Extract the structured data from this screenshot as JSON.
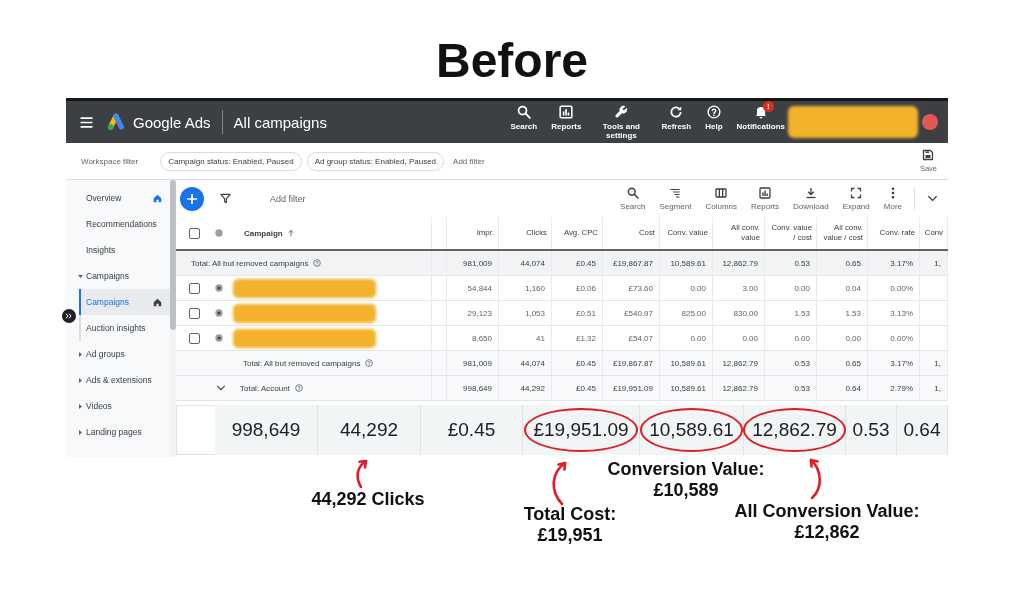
{
  "heading": "Before",
  "top_bar": {
    "product_name": "Google Ads",
    "page_title": "All campaigns",
    "actions": [
      {
        "label": "Search"
      },
      {
        "label": "Reports"
      },
      {
        "label": "Tools and settings"
      },
      {
        "label": "Refresh"
      },
      {
        "label": "Help"
      },
      {
        "label": "Notifications",
        "badge": "!"
      }
    ]
  },
  "filter_bar": {
    "label": "Workspace filter",
    "chips": [
      "Campaign status: Enabled, Paused",
      "Ad group status: Enabled, Paused"
    ],
    "add_filter": "Add filter",
    "save": "Save"
  },
  "sidebar": {
    "items": [
      {
        "label": "Overview",
        "selected": false,
        "home_page": true
      },
      {
        "label": "Recommendations",
        "selected": false,
        "home_page": false
      },
      {
        "label": "Insights",
        "selected": false,
        "home_page": false
      },
      {
        "label": "Campaigns",
        "selected": false,
        "home_page": false,
        "expanded": true,
        "children": [
          {
            "label": "Campaigns",
            "selected": true,
            "home_page": true
          },
          {
            "label": "Auction insights",
            "selected": false,
            "home_page": false
          }
        ]
      },
      {
        "label": "Ad groups",
        "selected": false,
        "home_page": false,
        "expanded": false
      },
      {
        "label": "Ads & extensions",
        "selected": false,
        "home_page": false,
        "expanded": false
      },
      {
        "label": "Videos",
        "selected": false,
        "home_page": false,
        "expanded": false
      },
      {
        "label": "Landing pages",
        "selected": false,
        "home_page": false,
        "expanded": false
      }
    ]
  },
  "toolbar": {
    "add_filter": "Add filter",
    "tools": [
      "Search",
      "Segment",
      "Columns",
      "Reports",
      "Download",
      "Expand",
      "More"
    ]
  },
  "table": {
    "header_checkbox": {
      "checked": false
    },
    "columns": [
      {
        "label": "Campaign",
        "sorted": true
      },
      {
        "label": "Impr.",
        "sorted": false
      },
      {
        "label": "Clicks",
        "sorted": false
      },
      {
        "label": "Avg. CPC",
        "sorted": false
      },
      {
        "label": "Cost",
        "sorted": false
      },
      {
        "label": "Conv. value",
        "sorted": false
      },
      {
        "label": "All conv. value",
        "sorted": false
      },
      {
        "label": "Conv. value / cost",
        "sorted": false
      },
      {
        "label": "All conv. value / cost",
        "sorted": false
      },
      {
        "label": "Conv. rate",
        "sorted": false
      },
      {
        "label": "Conv",
        "sorted": false
      }
    ],
    "rows": [
      {
        "kind": "total",
        "cells": [
          "Total: All but removed campaigns",
          "981,009",
          "44,074",
          "£0.45",
          "£19,867.87",
          "10,589.61",
          "12,862.79",
          "0.53",
          "0.65",
          "3.17%",
          "1,"
        ]
      },
      {
        "kind": "campaign",
        "checked": false,
        "cells": [
          "",
          "54,844",
          "1,160",
          "£0.06",
          "£73.60",
          "0.00",
          "3.00",
          "0.00",
          "0.04",
          "0.00%"
        ]
      },
      {
        "kind": "campaign",
        "checked": false,
        "cells": [
          "",
          "29,123",
          "1,053",
          "£0.51",
          "£540.97",
          "825.00",
          "830.00",
          "1.53",
          "1.53",
          "3.13%"
        ]
      },
      {
        "kind": "campaign",
        "checked": false,
        "cells": [
          "",
          "8,650",
          "41",
          "£1.32",
          "£54.07",
          "0.00",
          "0.00",
          "0.00",
          "0.00",
          "0.00%"
        ]
      },
      {
        "kind": "subtotal",
        "cells": [
          "Total: All but removed campaigns",
          "981,009",
          "44,074",
          "£0.45",
          "£19,867.87",
          "10,589.61",
          "12,862.79",
          "0.53",
          "0.65",
          "3.17%",
          "1,"
        ]
      },
      {
        "kind": "account",
        "expanded": true,
        "cells": [
          "Total: Account",
          "998,649",
          "44,292",
          "£0.45",
          "£19,951.09",
          "10,589.61",
          "12,862.79",
          "0.53",
          "0.64",
          "2.79%",
          "1,"
        ]
      }
    ]
  },
  "magnified_totals": [
    {
      "value": "998,649",
      "circled": false
    },
    {
      "value": "44,292",
      "circled": false
    },
    {
      "value": "£0.45",
      "circled": false
    },
    {
      "value": "£19,951.09",
      "circled": true
    },
    {
      "value": "10,589.61",
      "circled": true
    },
    {
      "value": "12,862.79",
      "circled": true
    },
    {
      "value": "0.53",
      "circled": false
    },
    {
      "value": "0.64",
      "circled": false
    }
  ],
  "annotations": [
    {
      "lines": [
        "44,292 Clicks"
      ],
      "arrow": true
    },
    {
      "lines": [
        "Total Cost:",
        "£19,951"
      ],
      "arrow": true
    },
    {
      "lines": [
        "Conversion Value:",
        "£10,589"
      ],
      "arrow": false
    },
    {
      "lines": [
        "All Conversion Value:",
        "£12,862"
      ],
      "arrow": true
    }
  ]
}
